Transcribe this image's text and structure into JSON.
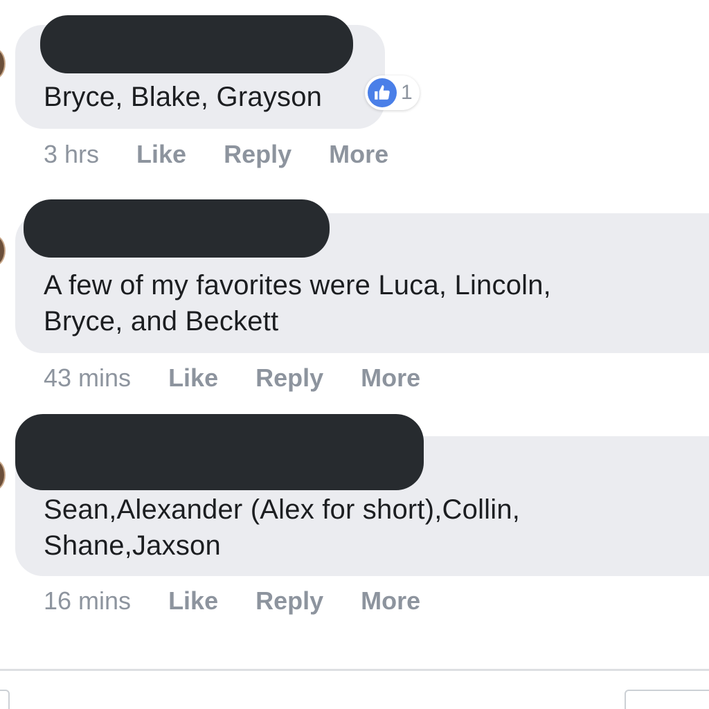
{
  "comments": [
    {
      "text": "Bryce, Blake, Grayson",
      "time": "3 hrs",
      "like_label": "Like",
      "reply_label": "Reply",
      "more_label": "More",
      "reaction_count": "1"
    },
    {
      "text": "A few of my favorites were Luca, Lincoln,\nBryce, and Beckett",
      "time": "43 mins",
      "like_label": "Like",
      "reply_label": "Reply",
      "more_label": "More"
    },
    {
      "text": "Sean,Alexander (Alex for short),Collin,\nShane,Jaxson",
      "time": "16 mins",
      "like_label": "Like",
      "reply_label": "Reply",
      "more_label": "More"
    }
  ],
  "icons": {
    "reaction": "thumbs-up-icon"
  },
  "colors": {
    "bubble": "#ebecf0",
    "redaction": "#272b2f",
    "text": "#1c1e21",
    "meta": "#8d949e",
    "like_blue": "#4a7fe8"
  }
}
